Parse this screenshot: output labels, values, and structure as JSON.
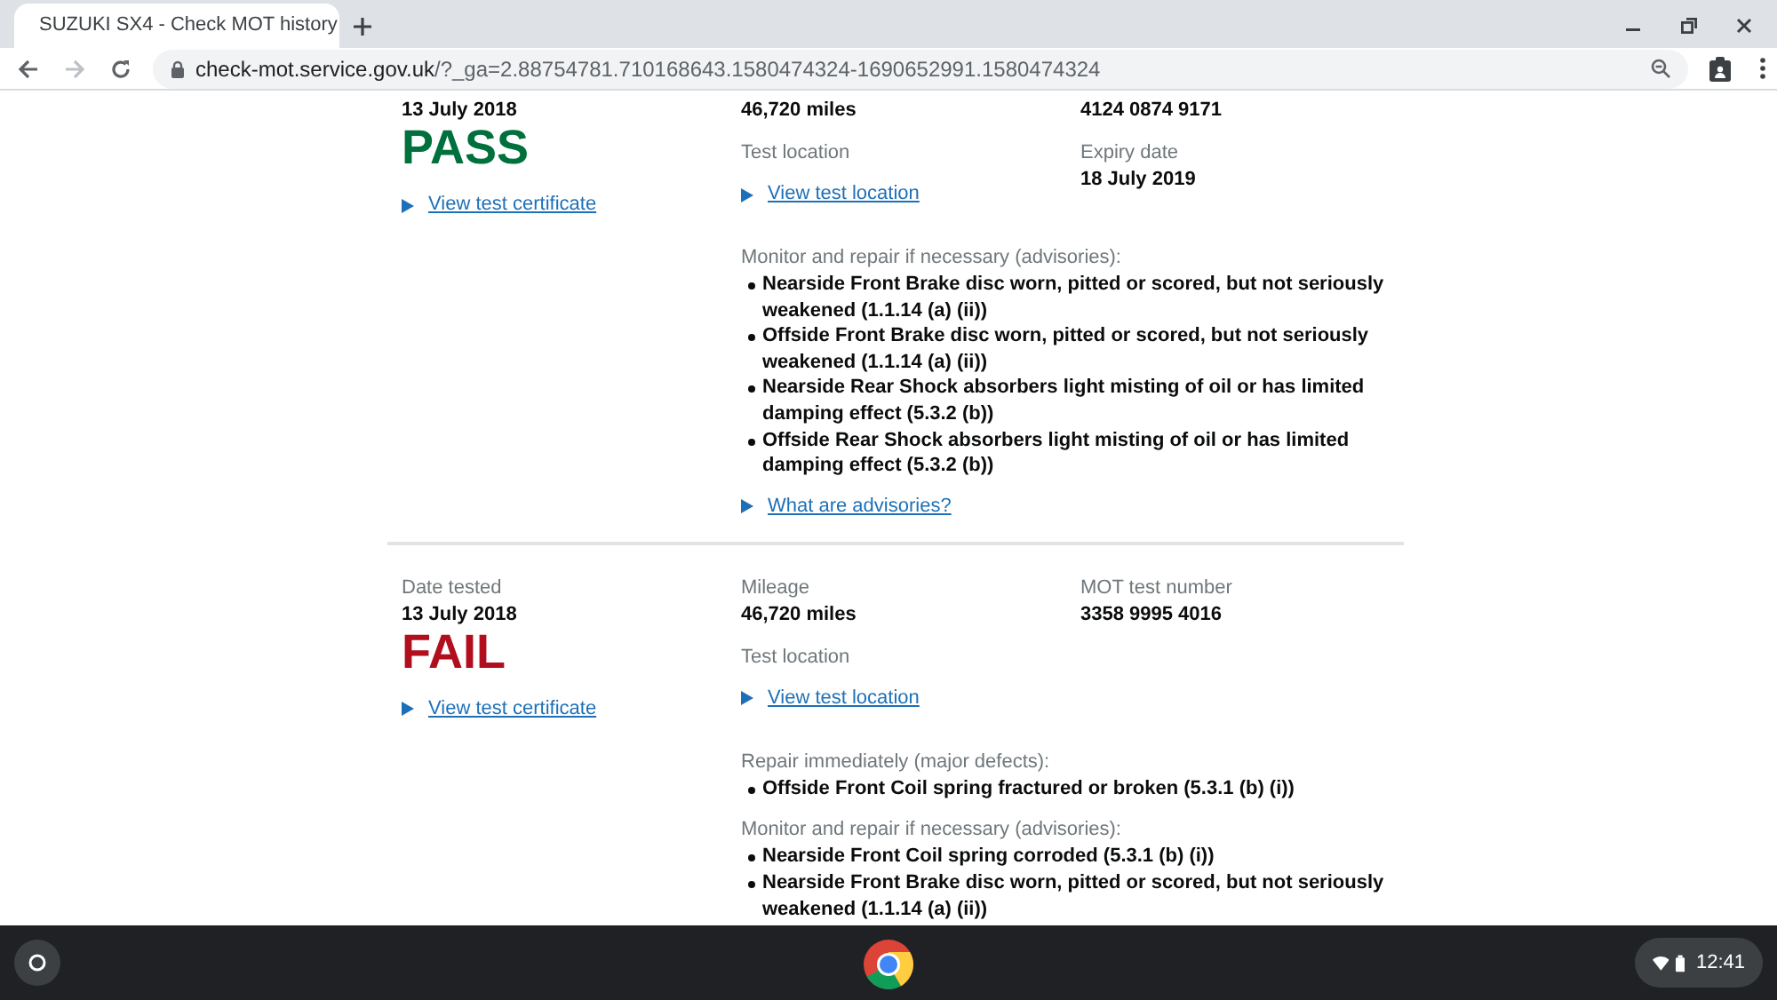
{
  "browser": {
    "tab": {
      "title": "SUZUKI SX4 - Check MOT history",
      "selected": true
    },
    "url": {
      "host": "check-mot.service.gov.uk",
      "path": "/?_ga=2.88754781.710168643.1580474324-1690652991.1580474324"
    }
  },
  "records": [
    {
      "date": "13 July 2018",
      "result": {
        "kind": "pass",
        "text": "PASS"
      },
      "certificate_link": "View test certificate",
      "mileage": "46,720 miles",
      "number": "4124 0874 9171",
      "location_label": "Test location",
      "location_link": "View test location",
      "expiry_label": "Expiry date",
      "expiry": "18 July 2019",
      "defect_groups": [
        {
          "label": "Monitor and repair if necessary (advisories):",
          "items": [
            "Nearside Front Brake disc worn, pitted or scored, but not seriously weakened (1.1.14 (a) (ii))",
            "Offside Front Brake disc worn, pitted or scored, but not seriously weakened (1.1.14 (a) (ii))",
            "Nearside Rear Shock absorbers light misting of oil or has limited damping effect (5.3.2 (b))",
            "Offside Rear Shock absorbers light misting of oil or has limited damping effect (5.3.2 (b))"
          ]
        }
      ],
      "advisory_link": "What are advisories?"
    },
    {
      "date_label": "Date tested",
      "date": "13 July 2018",
      "result": {
        "kind": "fail",
        "text": "FAIL"
      },
      "certificate_link": "View test certificate",
      "mileage_label": "Mileage",
      "mileage": "46,720 miles",
      "number_label": "MOT test number",
      "number": "3358 9995 4016",
      "location_label": "Test location",
      "location_link": "View test location",
      "defect_groups": [
        {
          "label": "Repair immediately (major defects):",
          "items": [
            "Offside Front Coil spring fractured or broken (5.3.1 (b) (i))"
          ]
        },
        {
          "label": "Monitor and repair if necessary (advisories):",
          "items": [
            "Nearside Front Coil spring corroded (5.3.1 (b) (i))",
            "Nearside Front Brake disc worn, pitted or scored, but not seriously weakened (1.1.14 (a) (ii))"
          ]
        }
      ]
    }
  ],
  "taskbar": {
    "time": "12:41"
  }
}
